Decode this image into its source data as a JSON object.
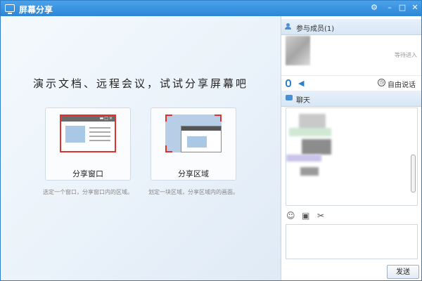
{
  "window": {
    "title": "屏幕分享"
  },
  "main": {
    "slogan": "演示文档、远程会议，试试分享屏幕吧",
    "share_window": {
      "label": "分享窗口",
      "description": "选定一个窗口，分享窗口内的区域。"
    },
    "share_region": {
      "label": "分享区域",
      "description": "划定一块区域，分享区域内的画面。"
    }
  },
  "sidebar": {
    "members_header": "参与成员(1)",
    "member_status": "等待进入",
    "free_speak_label": "自由说话",
    "chat_header": "聊天",
    "send_label": "发送"
  },
  "icons": {
    "title": "screen-icon",
    "members": "people-icon",
    "mic": "microphone-icon",
    "speaker": "speaker-icon",
    "free_speak": "clock-icon",
    "chat": "chat-bubble-icon",
    "emoji": "emoji-icon",
    "image": "image-icon",
    "screenshot": "scissors-icon"
  },
  "colors": {
    "accent": "#2f7fc8",
    "highlight": "#e03030"
  }
}
